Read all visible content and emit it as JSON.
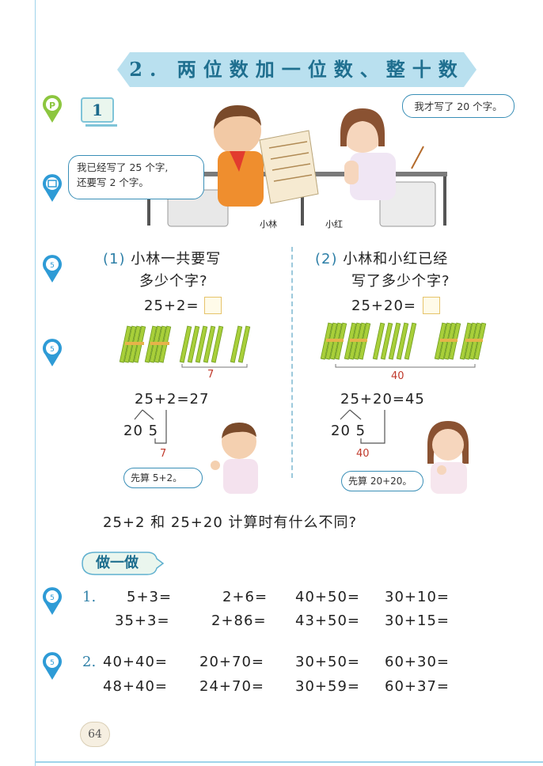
{
  "title": "2. 两位数加一位数、整十数",
  "example_number": "1",
  "scene": {
    "bubble_left": [
      "我已经写了 25 个字,",
      "还要写 2 个字。"
    ],
    "bubble_right": "我才写了 20 个字。",
    "name_boy": "小林",
    "name_girl": "小红"
  },
  "part1": {
    "label": "(1)",
    "question": [
      "小林一共要写",
      "多少个字?"
    ],
    "equation": "25+2=",
    "stick_label": "7",
    "result": "25+2=27",
    "split": "20 5",
    "split_label": "7",
    "hint": "先算 5+2。"
  },
  "part2": {
    "label": "(2)",
    "question": [
      "小林和小红已经",
      "写了多少个字?"
    ],
    "equation": "25+20=",
    "stick_label": "40",
    "result": "25+20=45",
    "split": "20 5",
    "split_label": "40",
    "hint": "先算 20+20。"
  },
  "compare_question": "25+2 和 25+20 计算时有什么不同?",
  "practice_label": "做一做",
  "exercises": [
    {
      "number": "1.",
      "rows": [
        [
          "5+3=",
          "2+6=",
          "40+50=",
          "30+10="
        ],
        [
          "35+3=",
          "2+86=",
          "43+50=",
          "30+15="
        ]
      ]
    },
    {
      "number": "2.",
      "rows": [
        [
          "40+40=",
          "20+70=",
          "30+50=",
          "60+30="
        ],
        [
          "48+40=",
          "24+70=",
          "30+59=",
          "60+37="
        ]
      ]
    }
  ],
  "page_number": "64",
  "colors": {
    "banner": "#b9e0ef",
    "accent": "#2d7fa7",
    "stick": "#a8cf3a",
    "red": "#c0392b"
  }
}
